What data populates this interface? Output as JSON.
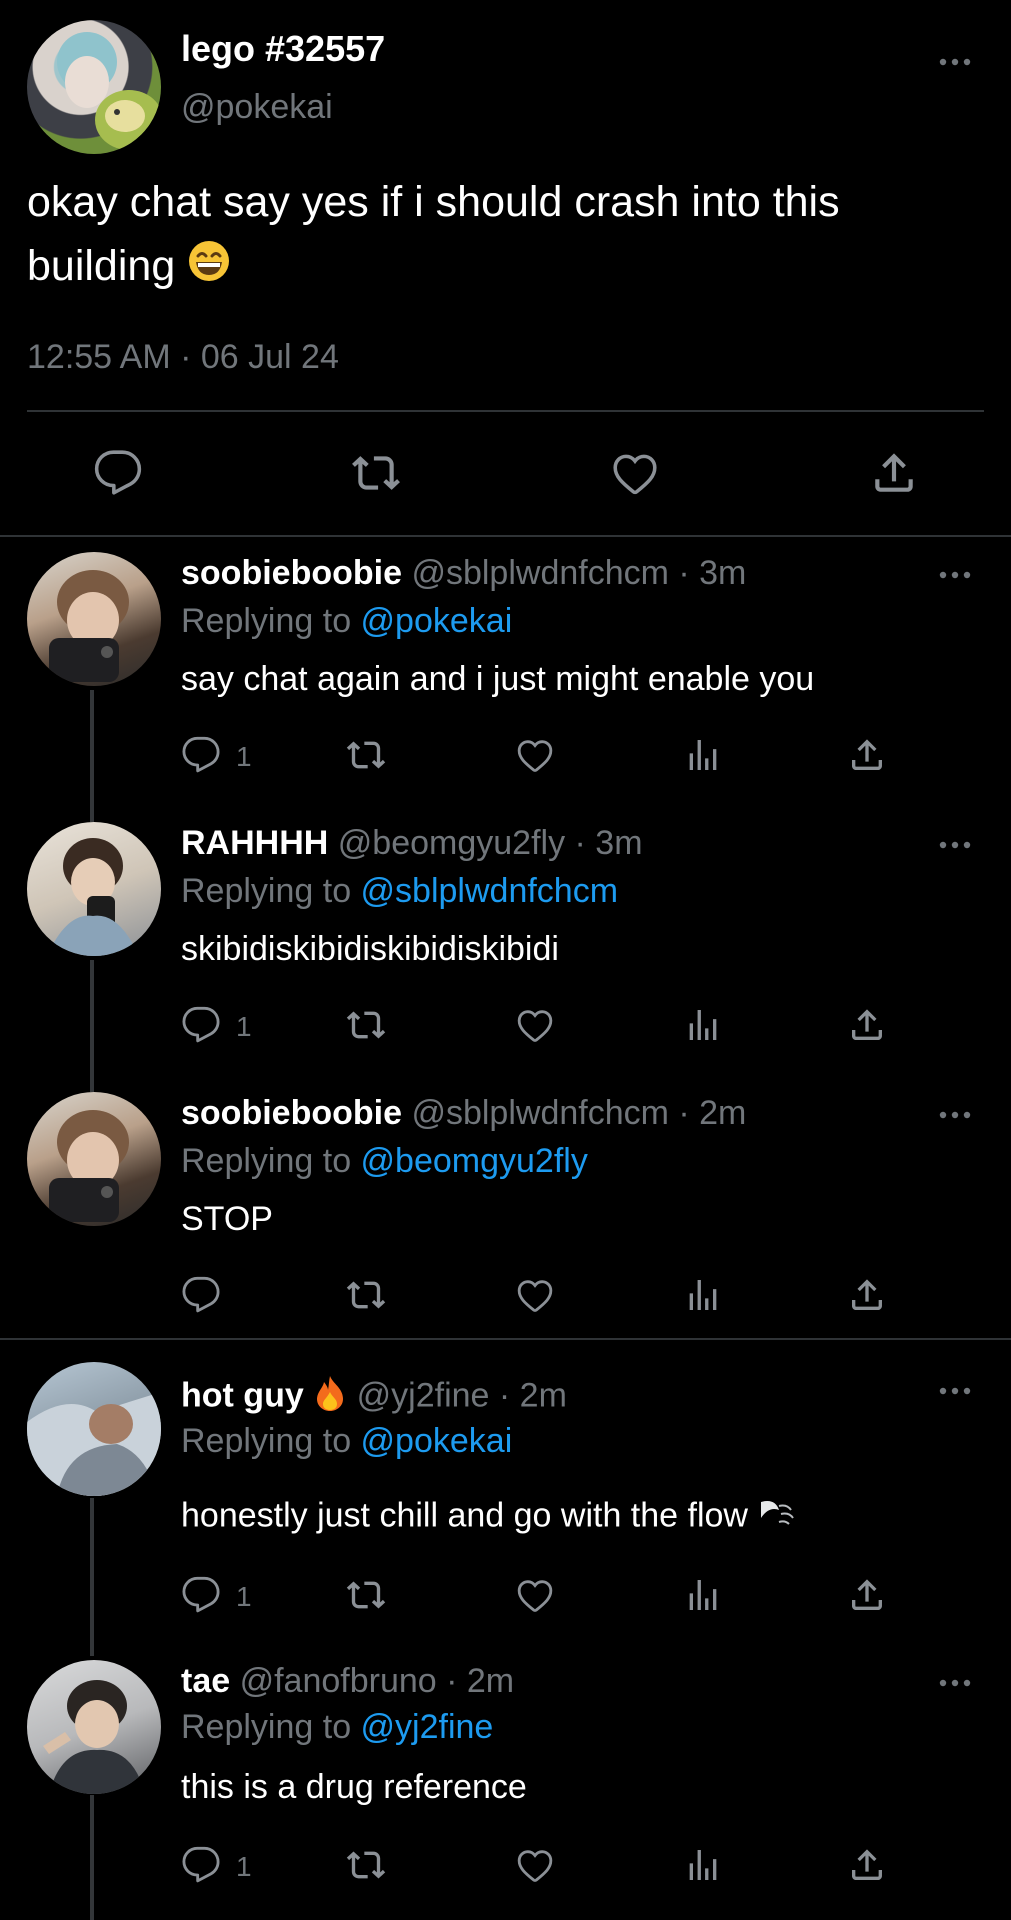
{
  "main_tweet": {
    "name": "lego #32557",
    "handle": "@pokekai",
    "text": "okay chat say yes if i should crash into this building",
    "emoji": "grinning-face-emoji",
    "time": "12:55 AM · 06 Jul 24"
  },
  "icons": {
    "reply": "reply-icon",
    "retweet": "retweet-icon",
    "like": "like-icon",
    "views": "views-icon",
    "share": "share-icon",
    "more": "more-icon"
  },
  "colors": {
    "background": "#000000",
    "text": "#ffffff",
    "muted": "#71767b",
    "link": "#1d9bf0",
    "divider": "#2f3336"
  },
  "replies": [
    {
      "name": "soobieboobie",
      "meta": " @sblplwdnfchcm · 3m",
      "replying_label": "Replying to ",
      "replying_to": "@pokekai",
      "text": "say chat again and i just might enable you",
      "reply_count": "1"
    },
    {
      "name": "RAHHHH",
      "meta": " @beomgyu2fly · 3m",
      "replying_label": "Replying to ",
      "replying_to": "@sblplwdnfchcm",
      "text": "skibidiskibidiskibidiskibidi",
      "reply_count": "1"
    },
    {
      "name": "soobieboobie",
      "meta": " @sblplwdnfchcm · 2m",
      "replying_label": "Replying to ",
      "replying_to": "@beomgyu2fly",
      "text": "STOP",
      "reply_count": ""
    },
    {
      "name": "hot guy",
      "name_emoji": "fire-emoji",
      "meta": "  @yj2fine · 2m",
      "replying_label": "Replying to ",
      "replying_to": "@pokekai",
      "text": "honestly just chill and go with the flow",
      "text_emoji": "wind-emoji",
      "reply_count": "1"
    },
    {
      "name": "tae",
      "meta": "  @fanofbruno · 2m",
      "replying_label": "Replying to ",
      "replying_to": "@yj2fine",
      "text": "this is a drug reference",
      "reply_count": "1"
    }
  ]
}
